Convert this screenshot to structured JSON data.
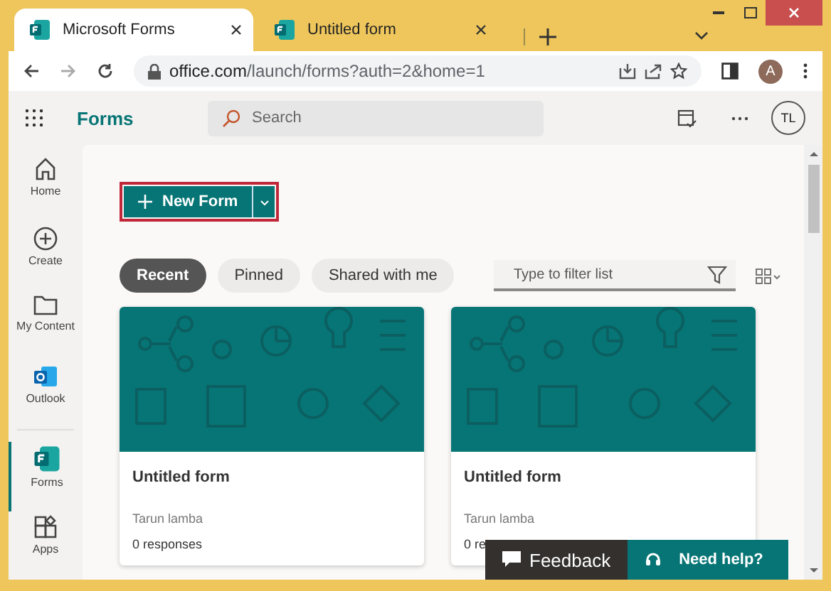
{
  "browser": {
    "tabs": [
      {
        "title": "Microsoft Forms",
        "selected": true
      },
      {
        "title": "Untitled form",
        "selected": false
      }
    ],
    "url_host": "office.com",
    "url_path": "/launch/forms?auth=2&home=1",
    "profile": "A"
  },
  "app": {
    "name": "Forms",
    "search": {
      "placeholder": "Search"
    },
    "avatar": "TL"
  },
  "rail": [
    {
      "label": "Home",
      "kind": "home",
      "selected": false
    },
    {
      "label": "Create",
      "kind": "create",
      "selected": false
    },
    {
      "label": "My Content",
      "kind": "folder",
      "selected": false
    },
    {
      "label": "Outlook",
      "kind": "outlook",
      "selected": false
    },
    {
      "label": "Forms",
      "kind": "forms",
      "selected": true
    },
    {
      "label": "Apps",
      "kind": "apps",
      "selected": false
    }
  ],
  "new_form_button": {
    "label": "New Form"
  },
  "filters": [
    {
      "label": "Recent",
      "selected": true
    },
    {
      "label": "Pinned",
      "selected": false
    },
    {
      "label": "Shared with me",
      "selected": false
    }
  ],
  "filter_field": {
    "placeholder": "Type to filter list"
  },
  "cards": [
    {
      "title": "Untitled form",
      "owner": "Tarun lamba",
      "responses": "0 responses"
    },
    {
      "title": "Untitled form",
      "owner": "Tarun lamba",
      "responses": "0 re"
    }
  ],
  "help": {
    "feedback": "Feedback",
    "need_help": "Need help?"
  }
}
